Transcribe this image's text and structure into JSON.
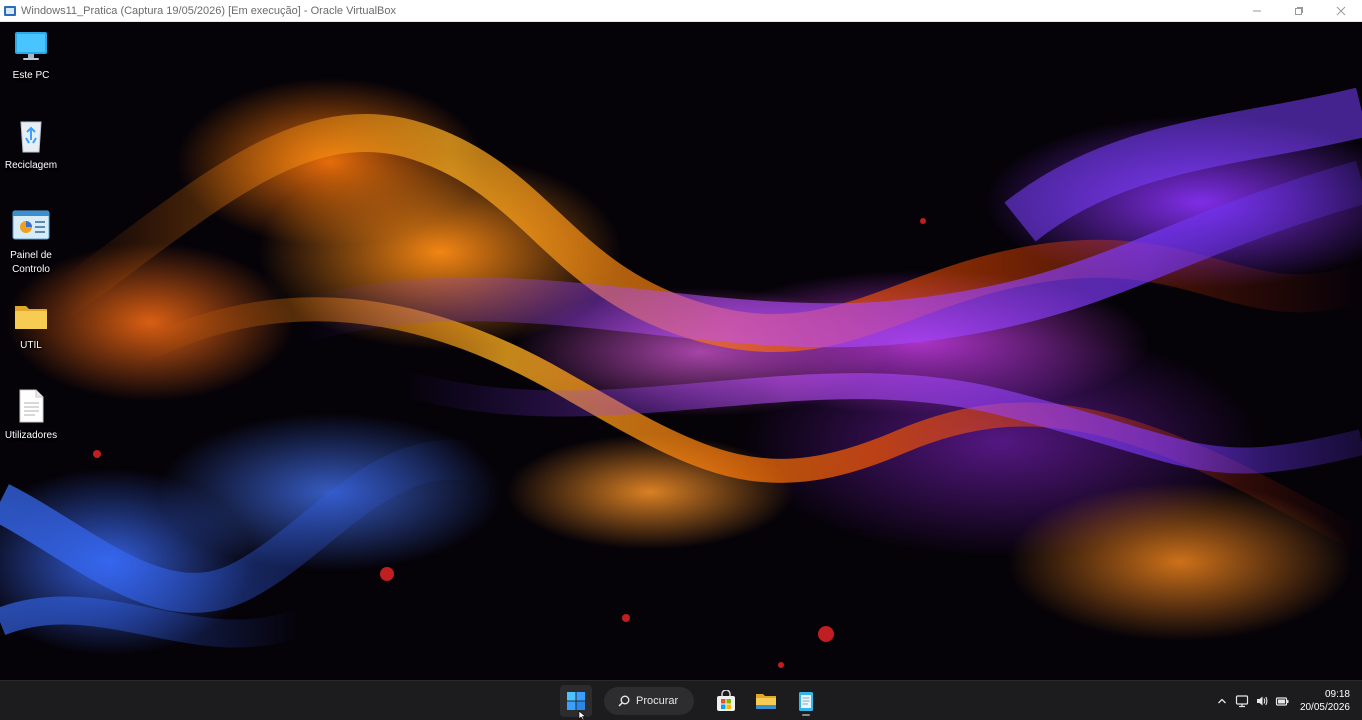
{
  "window": {
    "title": "Windows11_Pratica (Captura 19/05/2026) [Em execução] - Oracle VirtualBox",
    "app_icon": "virtualbox-icon",
    "buttons": [
      "minimize-icon",
      "restore-icon",
      "close-icon"
    ]
  },
  "desktop": {
    "icons": [
      {
        "label": "Este PC",
        "icon": "computer-monitor-icon"
      },
      {
        "label": "Reciclagem",
        "icon": "recycle-bin-icon"
      },
      {
        "label": "Painel de\nControlo",
        "icon": "control-panel-icon"
      },
      {
        "label": "UTIL",
        "icon": "folder-icon"
      },
      {
        "label": "Utilizadores",
        "icon": "text-document-icon"
      }
    ],
    "wallpaper": "abstract orange-purple-blue flames on black"
  },
  "taskbar": {
    "search_label": "Procurar",
    "pinned": [
      "windows-start-icon",
      "search-icon",
      "microsoft-store-icon",
      "file-explorer-icon",
      "notepad-icon"
    ],
    "tray": {
      "icons": [
        "chevron-up-icon",
        "network-icon",
        "volume-icon",
        "battery-icon"
      ],
      "time": "09:18",
      "date": "20/05/2026"
    }
  },
  "colors": {
    "taskbar_bg": "#1c1c1e",
    "start_blue": "#3aa0ff",
    "folder_yellow": "#f3c444"
  }
}
